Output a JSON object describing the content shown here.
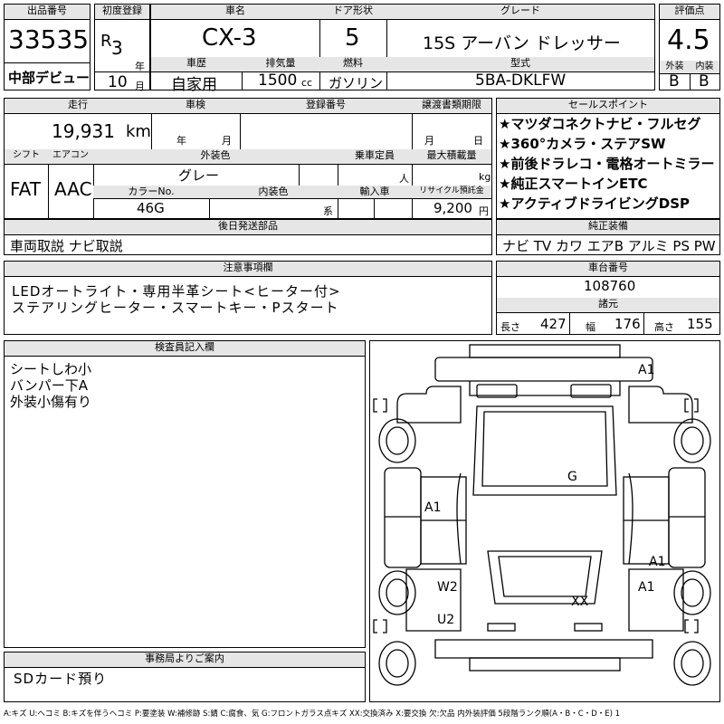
{
  "header": {
    "lot_label": "出品番号",
    "lot_number": "33535",
    "market": "中部デビュー",
    "first_reg_label": "初度登録",
    "era_prefix": "R",
    "year": "3",
    "year_unit": "年",
    "month": "10",
    "month_unit": "月",
    "car_name_label": "車名",
    "car_name": "CX-3",
    "door_label": "ドア形状",
    "door": "5",
    "grade_label": "グレード",
    "grade": "15S アーバン ドレッサー",
    "history_label": "車歴",
    "history": "自家用",
    "displacement_label": "排気量",
    "displacement": "1500",
    "displacement_unit": "cc",
    "fuel_label": "燃料",
    "fuel": "ガソリン",
    "model_label": "型式",
    "model": "5BA-DKLFW",
    "score_label": "評価点",
    "score": "4.5",
    "exterior_label": "外装",
    "exterior": "B",
    "interior_label": "内装",
    "interior": "B"
  },
  "row2": {
    "mileage_label": "走行",
    "mileage": "19,931",
    "mileage_unit": "km",
    "inspection_label": "車検",
    "insp_year_unit": "年",
    "insp_month_unit": "月",
    "reg_label": "登録番号",
    "transfer_label": "譲渡書類期限",
    "transfer_month_unit": "月",
    "transfer_day_unit": "日",
    "shift_label": "シフト",
    "shift": "FAT",
    "ac_label": "エアコン",
    "ac": "AAC",
    "color_label": "外装色",
    "color": "グレー",
    "capacity_label": "乗車定員",
    "capacity_unit": "人",
    "load_label": "最大積載量",
    "load_unit": "kg",
    "color_no_label": "カラーNo.",
    "color_no": "46G",
    "interior_color_label": "内装色",
    "interior_color_unit": "系",
    "import_label": "輸入車",
    "recycle_label": "リサイクル預託金",
    "recycle": "9,200",
    "recycle_unit": "円"
  },
  "sales_points": {
    "label": "セールスポイント",
    "items": [
      "★マツダコネクトナビ・フルセグ",
      "★360°カメラ・ステアSW",
      "★前後ドラレコ・電格オートミラー",
      "★純正スマートインETC",
      "★アクティブドライビングDSP"
    ]
  },
  "delivery": {
    "label": "後日発送部品",
    "text": "車両取説 ナビ取説"
  },
  "equipment": {
    "label": "純正装備",
    "text": "ナビ TV カワ エアB アルミ PS PW"
  },
  "notes": {
    "label": "注意事項欄",
    "lines": [
      "LEDオートライト・専用半革シート<ヒーター付>",
      "ステアリングヒーター・スマートキー・Pスタート"
    ]
  },
  "chassis": {
    "label": "車台番号",
    "value": "108760"
  },
  "dimensions": {
    "label": "諸元",
    "length_label": "長さ",
    "length": "427",
    "width_label": "幅",
    "width": "176",
    "height_label": "高さ",
    "height": "155"
  },
  "inspector": {
    "label": "検査員記入欄",
    "lines": [
      "シートしわ小",
      "バンパー下A",
      "外装小傷有り"
    ]
  },
  "diagram_marks": [
    "A1",
    "G",
    "A1",
    "A1",
    "A1",
    "W2",
    "XX",
    "U2"
  ],
  "office": {
    "label": "事務局よりご案内",
    "text": "SDカード預り"
  },
  "legend": "A:キズ U:ヘコミ B:キズを伴うヘコミ P:要塗装 W:補修跡 S:錆 C:腐食、気 G:フロントガラス点キズ XX:交換済み X:要交換 欠:欠品 内外装評価 5段階ランク順(A・B・C・D・E) 1"
}
